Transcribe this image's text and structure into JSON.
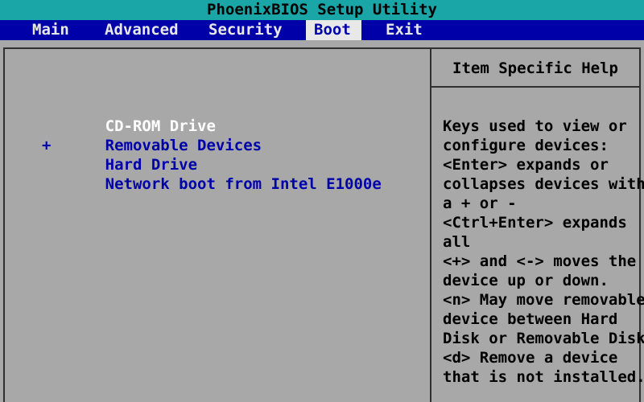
{
  "title": "PhoenixBIOS Setup Utility",
  "menu": {
    "tabs": [
      {
        "label": "Main",
        "active": false
      },
      {
        "label": "Advanced",
        "active": false
      },
      {
        "label": "Security",
        "active": false
      },
      {
        "label": "Boot",
        "active": true
      },
      {
        "label": "Exit",
        "active": false
      }
    ]
  },
  "boot": {
    "items": [
      {
        "label": "CD-ROM Drive",
        "marker": "",
        "selected": true
      },
      {
        "label": "Removable Devices",
        "marker": "",
        "selected": false
      },
      {
        "label": "Hard Drive",
        "marker": "+",
        "selected": false
      },
      {
        "label": "Network boot from Intel E1000e",
        "marker": "",
        "selected": false
      }
    ]
  },
  "help": {
    "title": "Item Specific Help",
    "lines": [
      "Keys used to view or",
      "configure devices:",
      "<Enter> expands or",
      "collapses devices with",
      "a + or -",
      "<Ctrl+Enter> expands",
      "all",
      "<+> and <-> moves the",
      "device up or down.",
      "<n> May move removable",
      "device between Hard",
      "Disk or Removable Disk",
      "<d> Remove a device",
      "that is not installed."
    ]
  },
  "colors": {
    "title_bar": "#1aa6a6",
    "menu_bar": "#0000a8",
    "background": "#a8a8a8",
    "item_text": "#0000a8",
    "selected_text": "#ffffff"
  }
}
